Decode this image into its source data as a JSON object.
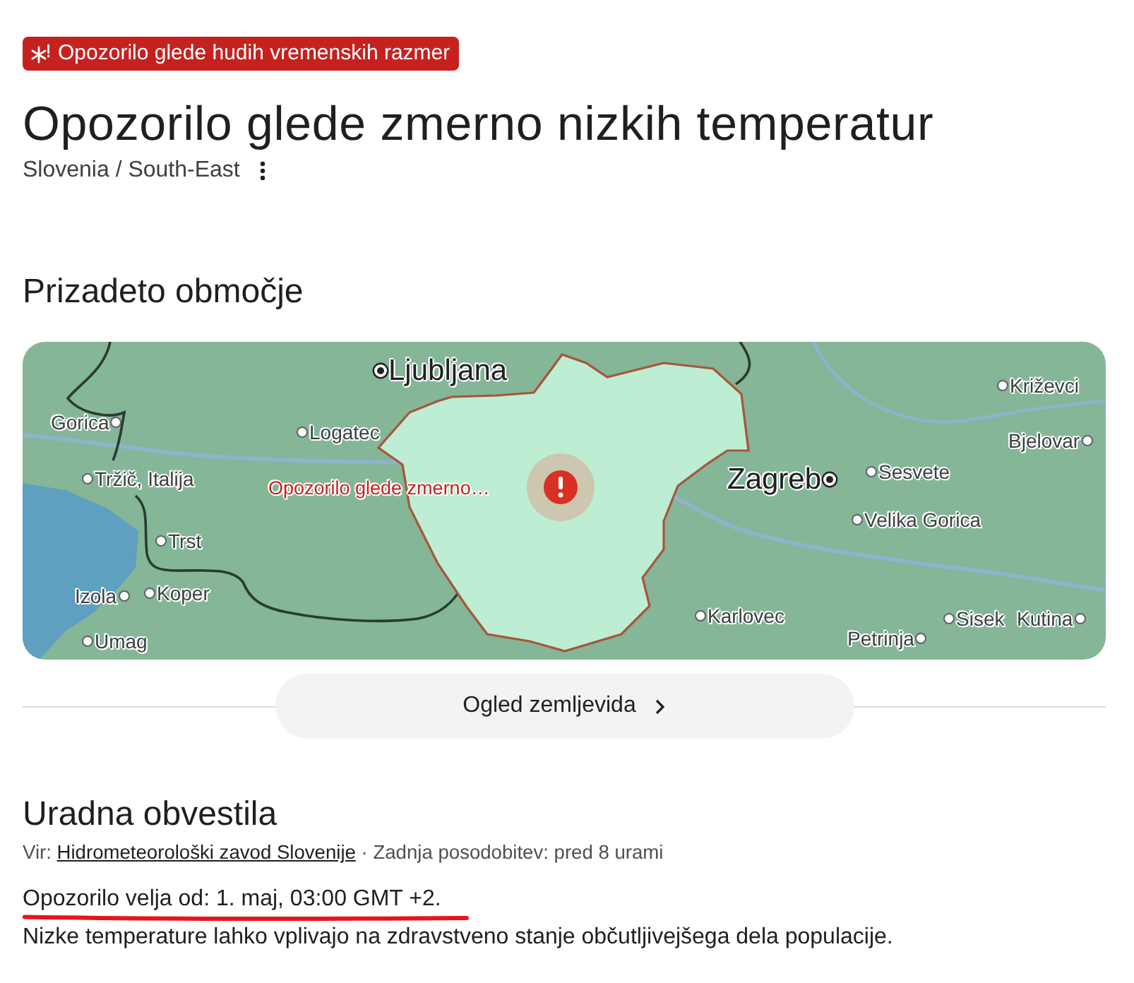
{
  "alert_badge": {
    "text": "Opozorilo glede hudih vremenskih razmer"
  },
  "title": "Opozorilo glede zmerno nizkih temperatur",
  "location": "Slovenia / South-East",
  "affected_area": {
    "heading": "Prizadeto območje",
    "map": {
      "labels": [
        {
          "text": "Ljubljana",
          "kind": "capital"
        },
        {
          "text": "Gorica",
          "kind": "city"
        },
        {
          "text": "Logatec",
          "kind": "city"
        },
        {
          "text": "Tržič, Italija",
          "kind": "city"
        },
        {
          "text": "Opozorilo glede zmerno…",
          "kind": "alert"
        },
        {
          "text": "Trst",
          "kind": "city"
        },
        {
          "text": "Izola",
          "kind": "city"
        },
        {
          "text": "Koper",
          "kind": "city"
        },
        {
          "text": "Umag",
          "kind": "city"
        },
        {
          "text": "Zagreb",
          "kind": "capital"
        },
        {
          "text": "Križevci",
          "kind": "city"
        },
        {
          "text": "Bjelovar",
          "kind": "city"
        },
        {
          "text": "Sesvete",
          "kind": "city"
        },
        {
          "text": "Velika Gorica",
          "kind": "city"
        },
        {
          "text": "Karlovec",
          "kind": "city"
        },
        {
          "text": "Sisek",
          "kind": "city"
        },
        {
          "text": "Kutina",
          "kind": "city"
        },
        {
          "text": "Petrinja",
          "kind": "city"
        }
      ]
    },
    "map_button": "Ogled zemljevida"
  },
  "notices": {
    "heading": "Uradna obvestila",
    "source_prefix": "Vir:",
    "source_link": "Hidrometeorološki zavod Slovenije",
    "updated": "· Zadnja posodobitev: pred 8 urami",
    "validity": {
      "text": "Opozorilo velja od: 1. maj, 03:00 GMT +2.",
      "highlighted": true
    },
    "body": "Nizke temperature lahko vplivajo na zdravstveno stanje občutljivejšega dela populacije."
  }
}
